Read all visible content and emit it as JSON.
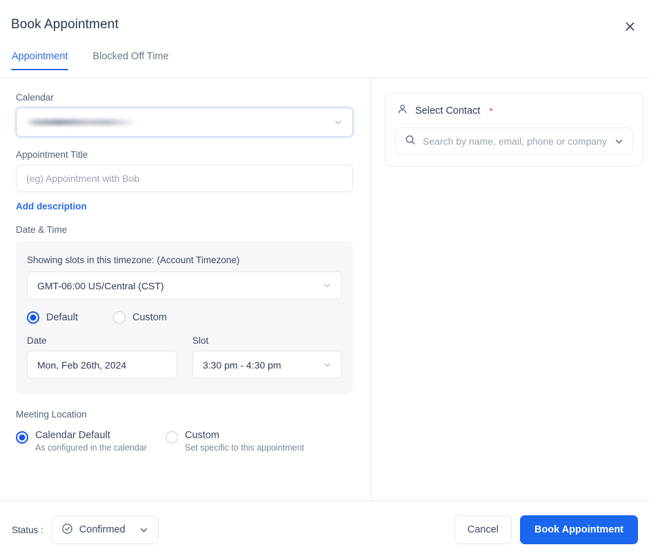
{
  "header": {
    "title": "Book Appointment",
    "close_icon": "close-icon"
  },
  "tabs": [
    {
      "label": "Appointment",
      "active": true
    },
    {
      "label": "Blocked Off Time",
      "active": false
    }
  ],
  "form": {
    "calendar": {
      "label": "Calendar",
      "value": "",
      "redacted": true,
      "chevron_icon": "chevron-down-icon"
    },
    "appointment_title": {
      "label": "Appointment Title",
      "value": "",
      "placeholder": "(eg) Appointment with Bob"
    },
    "add_description_link": "Add description",
    "date_time": {
      "section_label": "Date & Time",
      "timezone_note": "Showing slots in this timezone: (Account Timezone)",
      "timezone_value": "GMT-06:00 US/Central (CST)",
      "mode_options": [
        {
          "label": "Default",
          "selected": true
        },
        {
          "label": "Custom",
          "selected": false
        }
      ],
      "date": {
        "label": "Date",
        "value": "Mon, Feb 26th, 2024"
      },
      "slot": {
        "label": "Slot",
        "value": "3:30 pm - 4:30 pm"
      }
    },
    "meeting_location": {
      "section_label": "Meeting Location",
      "options": [
        {
          "title": "Calendar Default",
          "subtitle": "As configured in the calendar",
          "selected": true
        },
        {
          "title": "Custom",
          "subtitle": "Set specific to this appointment",
          "selected": false
        }
      ]
    }
  },
  "contact_panel": {
    "person_icon": "person-icon",
    "title": "Select Contact",
    "required_mark": "*",
    "search_icon": "search-icon",
    "search_placeholder": "Search by name, email, phone or company",
    "search_value": "",
    "chevron_icon": "chevron-down-icon"
  },
  "footer": {
    "status_label": "Status :",
    "status_value": "Confirmed",
    "status_icon": "check-circle-icon",
    "cancel_label": "Cancel",
    "submit_label": "Book Appointment"
  },
  "colors": {
    "accent_blue": "#1a66ef",
    "tab_active": "#2d6ae3",
    "link_blue": "#2d6ae3",
    "radio_blue": "#1557e8",
    "required_red": "#e8493f",
    "panel_gray": "#f6f7f9",
    "border_gray": "#e8eaef",
    "text_primary": "#2f3b52",
    "text_muted": "#9aa3b2"
  }
}
